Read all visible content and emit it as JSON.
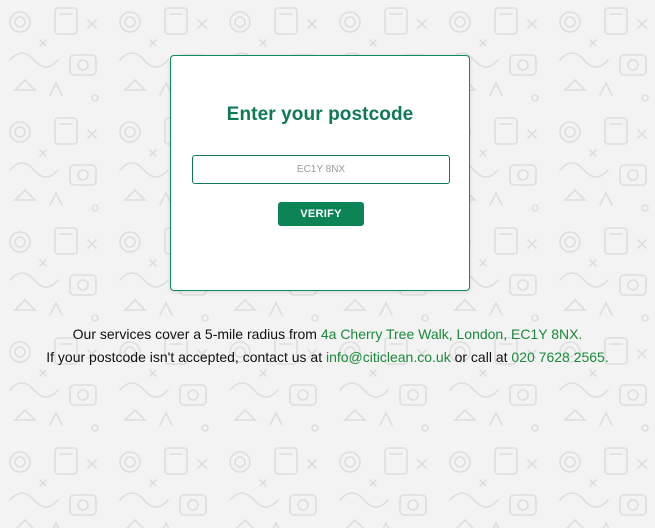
{
  "colors": {
    "accent": "#0f7a55",
    "button": "#0d8456",
    "link": "#1a8a3a",
    "background": "#f3f3f3"
  },
  "card": {
    "title": "Enter your postcode",
    "input_placeholder": "EC1Y 8NX",
    "input_value": "",
    "verify_label": "VERIFY"
  },
  "info": {
    "line1_prefix": "Our services cover a 5-mile radius from ",
    "address_link": "4a Cherry Tree Walk, London, EC1Y 8NX.",
    "line2_prefix": "If your postcode isn't accepted, contact us at ",
    "email_link": "info@citiclean.co.uk",
    "line2_middle": " or call at ",
    "phone_link": "020 7628 2565."
  }
}
